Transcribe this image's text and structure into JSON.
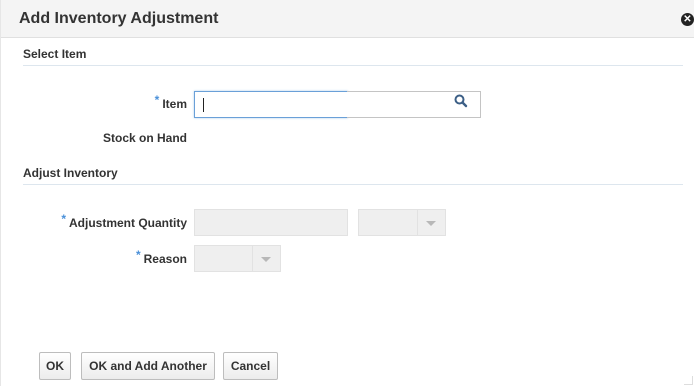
{
  "dialog": {
    "title": "Add Inventory Adjustment",
    "close_icon": "close-circle-icon"
  },
  "select_item": {
    "section_title": "Select Item",
    "item_label": "Item",
    "item_required_mark": "*",
    "item_value": "",
    "search_icon": "magnifier-icon",
    "stock_on_hand_label": "Stock on Hand",
    "stock_on_hand_value": ""
  },
  "adjust_inventory": {
    "section_title": "Adjust Inventory",
    "quantity_label": "Adjustment Quantity",
    "quantity_required_mark": "*",
    "quantity_value": "",
    "uom_value": "",
    "reason_label": "Reason",
    "reason_required_mark": "*",
    "reason_value": ""
  },
  "buttons": {
    "ok": "OK",
    "ok_add_another": "OK and Add Another",
    "cancel": "Cancel"
  }
}
